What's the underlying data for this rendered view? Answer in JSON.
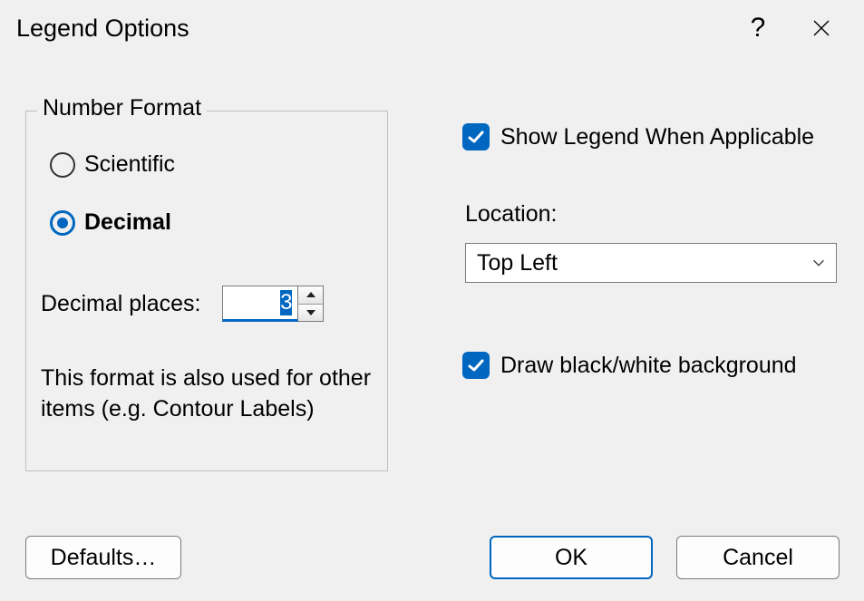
{
  "window": {
    "title": "Legend Options",
    "help_icon": "?"
  },
  "number_format": {
    "legend": "Number Format",
    "scientific_label": "Scientific",
    "decimal_label": "Decimal",
    "selected": "decimal",
    "decimal_places_label": "Decimal places:",
    "decimal_places_value": "3",
    "note": "This format is also used for other items (e.g. Contour Labels)"
  },
  "options": {
    "show_legend_label": "Show Legend When Applicable",
    "show_legend_checked": true,
    "location_label": "Location:",
    "location_value": "Top Left",
    "bw_background_label": "Draw black/white background",
    "bw_background_checked": true
  },
  "buttons": {
    "defaults": "Defaults…",
    "ok": "OK",
    "cancel": "Cancel"
  }
}
